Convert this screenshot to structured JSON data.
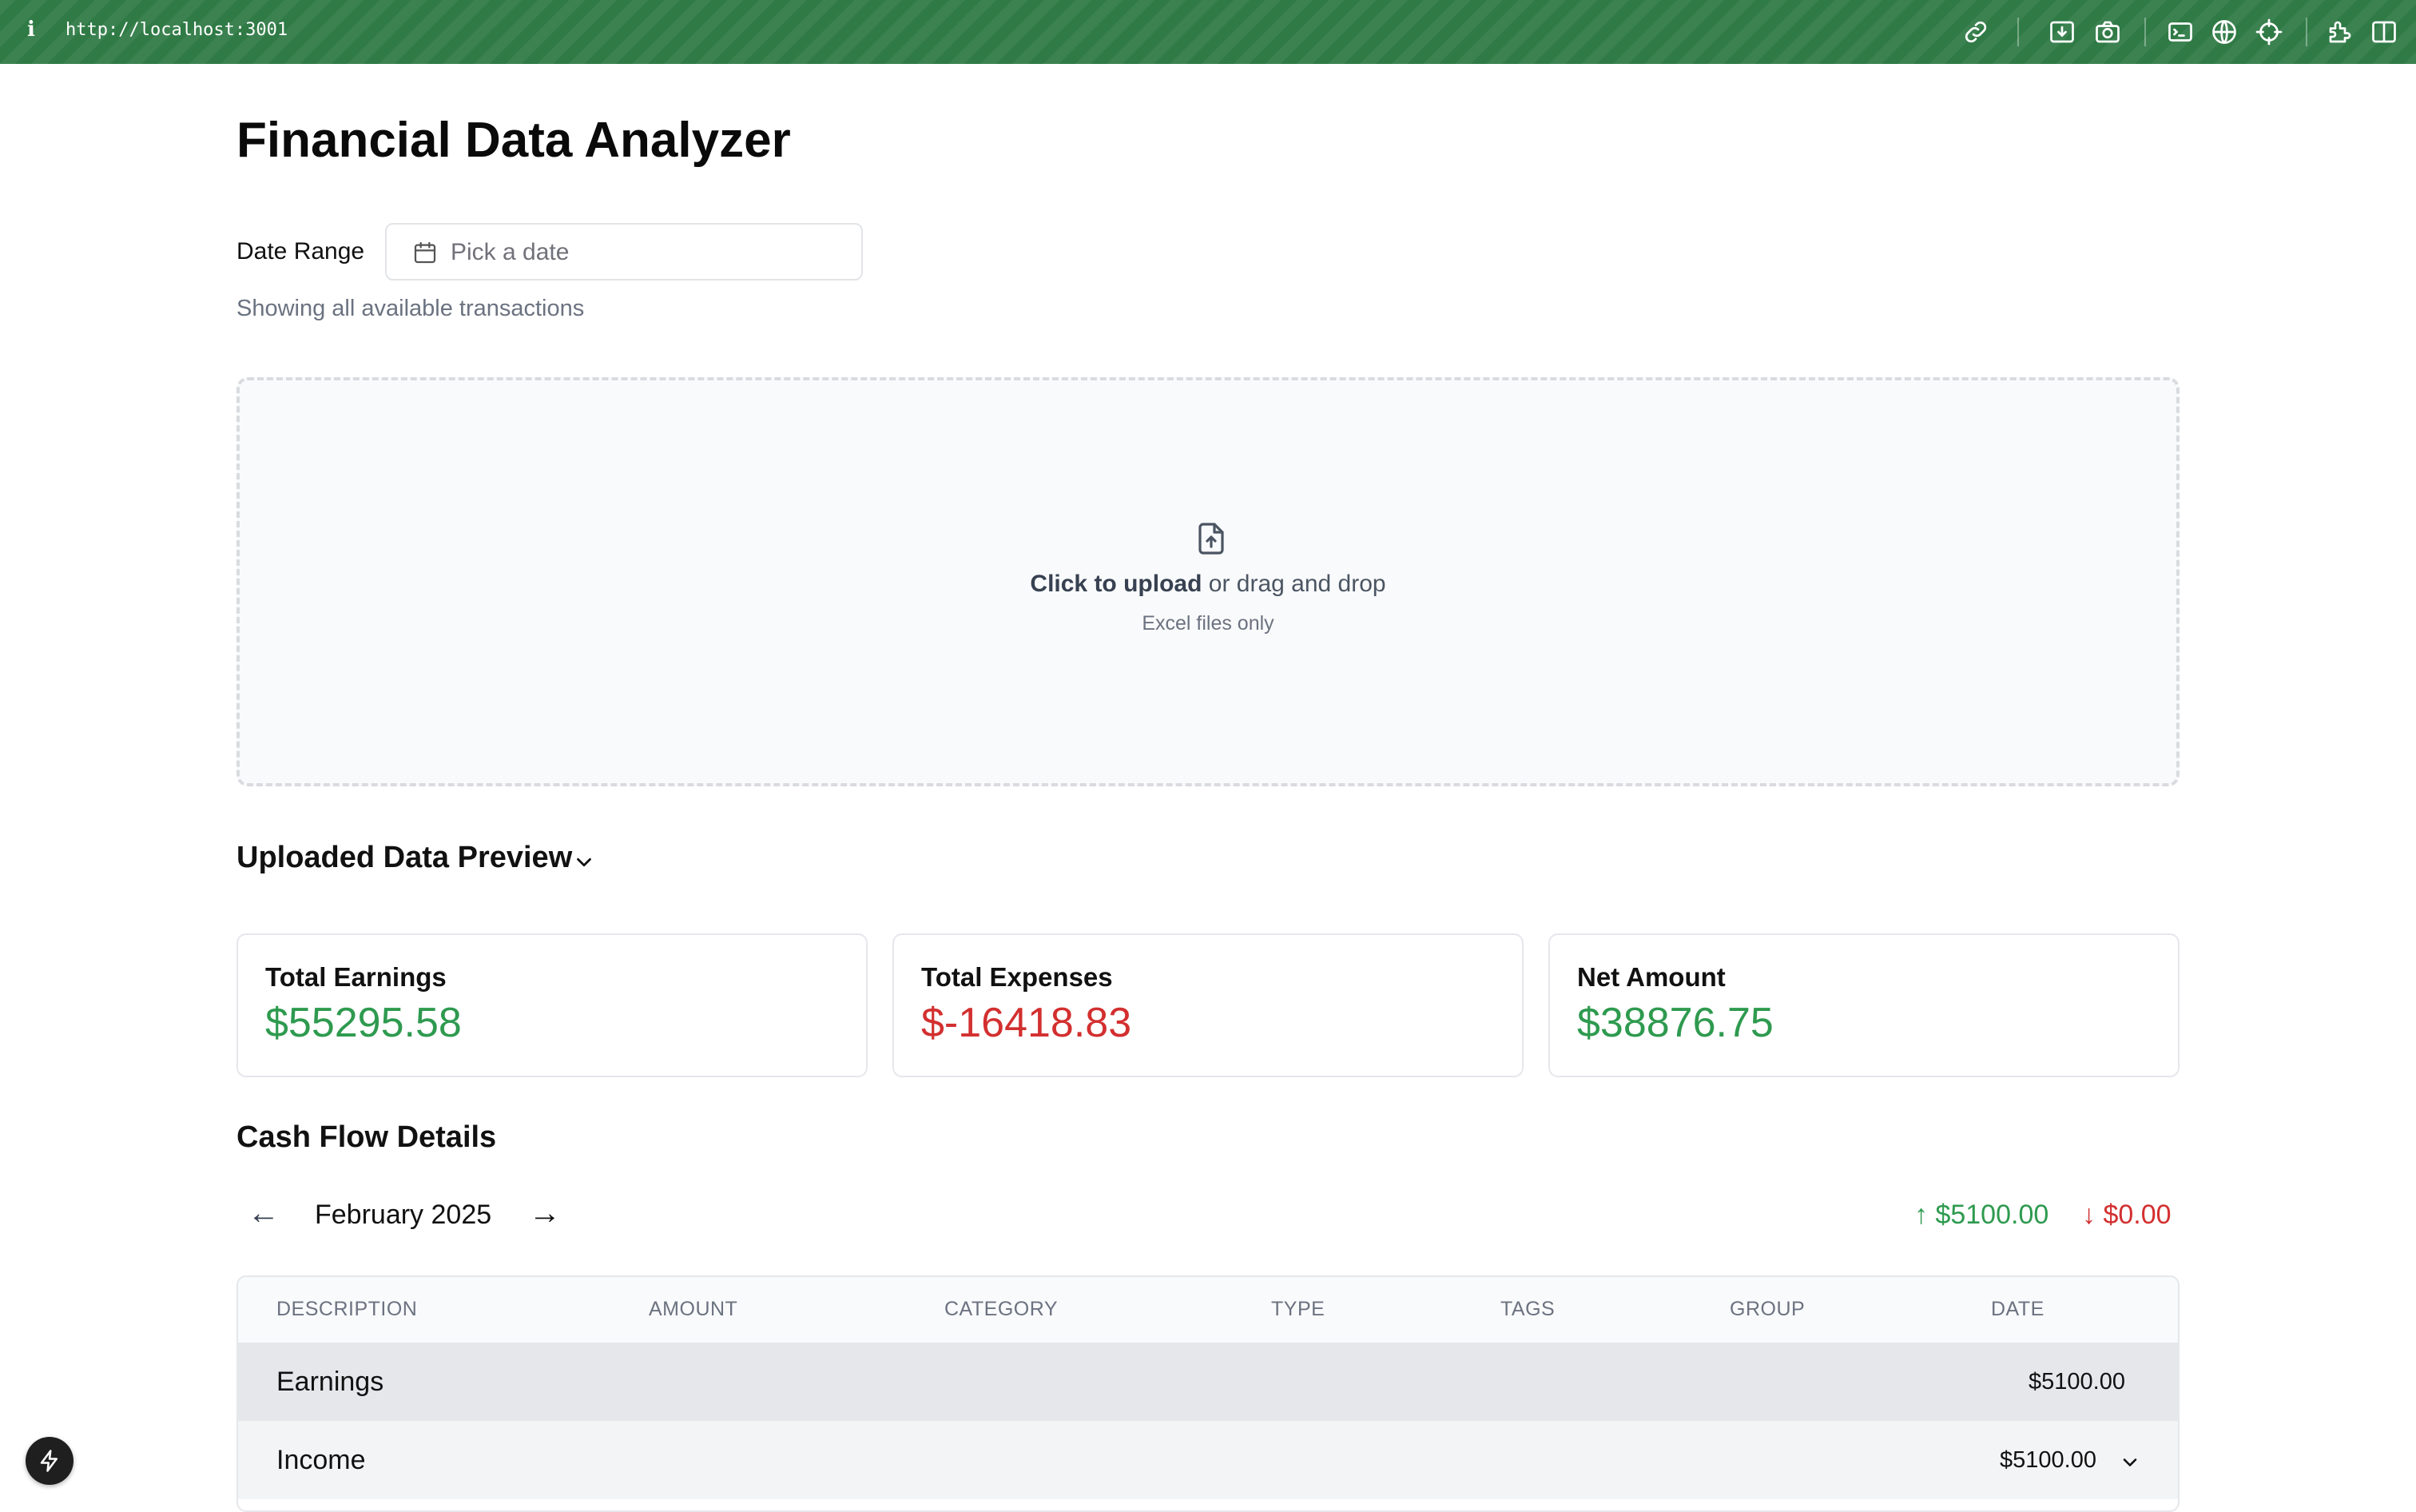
{
  "browser": {
    "info_label": "i",
    "url": "http://localhost:3001",
    "icons": [
      "link-icon",
      "download-icon",
      "camera-icon",
      "terminal-icon",
      "globe-icon",
      "crosshair-icon",
      "extensions-icon",
      "split-view-icon"
    ]
  },
  "page": {
    "title": "Financial Data Analyzer"
  },
  "date_range": {
    "label": "Date Range",
    "placeholder": "Pick a date",
    "hint": "Showing all available transactions"
  },
  "upload": {
    "cta_bold": "Click to upload",
    "cta_rest": " or drag and drop",
    "sub": "Excel files only"
  },
  "preview": {
    "title": "Uploaded Data Preview"
  },
  "summary": {
    "earnings": {
      "label": "Total Earnings",
      "value": "$55295.58",
      "color": "#2e9a4f"
    },
    "expenses": {
      "label": "Total Expenses",
      "value": "$-16418.83",
      "color": "#d32f2f"
    },
    "net": {
      "label": "Net Amount",
      "value": "$38876.75",
      "color": "#2e9a4f"
    }
  },
  "cashflow": {
    "title": "Cash Flow Details",
    "prev_arrow": "←",
    "next_arrow": "→",
    "month": "February 2025",
    "inflow": "↑ $5100.00",
    "outflow": "↓ $0.00",
    "columns": [
      "DESCRIPTION",
      "AMOUNT",
      "CATEGORY",
      "TYPE",
      "TAGS",
      "GROUP",
      "DATE"
    ],
    "rows": [
      {
        "name": "Earnings",
        "amount": "$5100.00"
      },
      {
        "name": "Income",
        "amount": "$5100.00"
      }
    ]
  }
}
